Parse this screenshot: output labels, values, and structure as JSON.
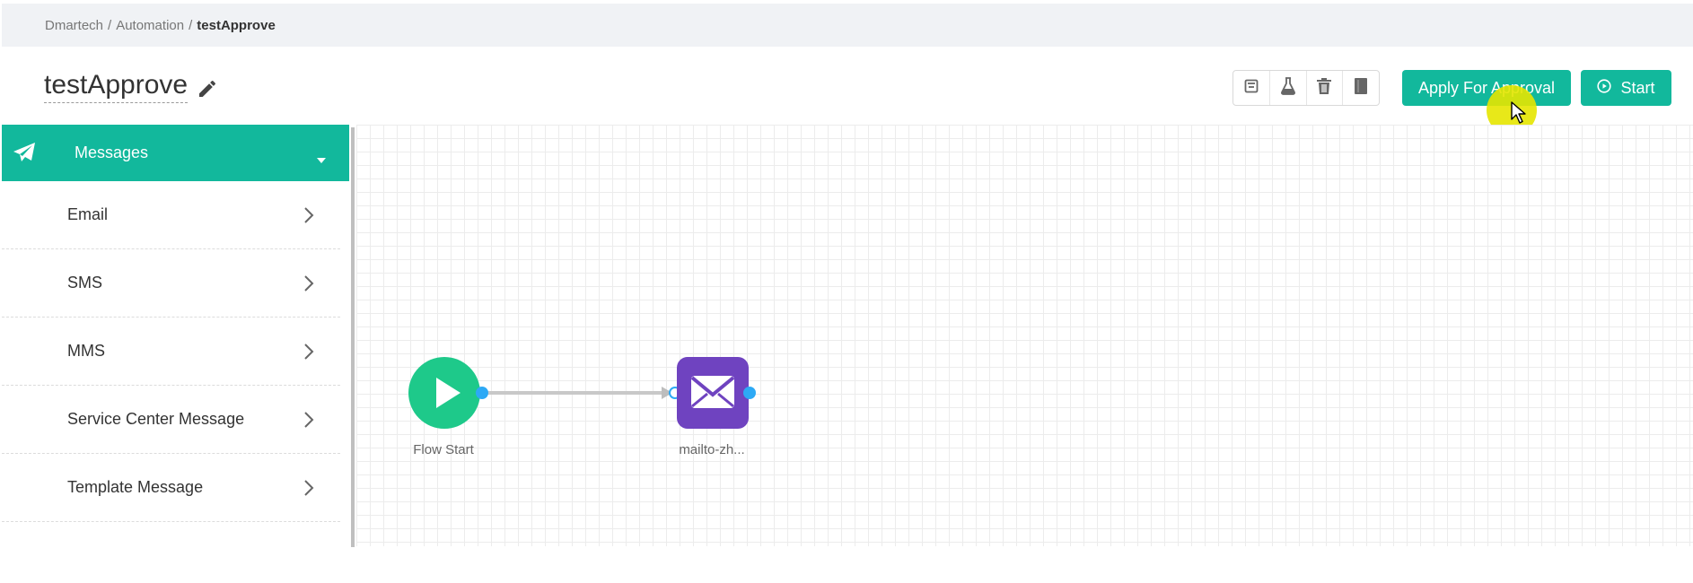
{
  "breadcrumb": {
    "items": [
      "Dmartech",
      "Automation"
    ],
    "separator": "/",
    "current": "testApprove"
  },
  "header": {
    "title": "testApprove",
    "edit_icon": "pencil-icon",
    "tools": [
      "save-icon",
      "flask-icon",
      "trash-icon",
      "notebook-icon"
    ],
    "apply_label": "Apply For Approval",
    "start_label": "Start",
    "accent": "#12b89c"
  },
  "sidebar": {
    "header_label": "Messages",
    "header_icon": "paper-plane-icon",
    "items": [
      {
        "label": "Email"
      },
      {
        "label": "SMS"
      },
      {
        "label": "MMS"
      },
      {
        "label": "Service Center Message"
      },
      {
        "label": "Template Message"
      }
    ]
  },
  "canvas": {
    "nodes": [
      {
        "label": "Flow Start",
        "type": "start",
        "color": "#1ec98a"
      },
      {
        "label": "mailto-zh...",
        "type": "email",
        "color": "#6f43c0"
      }
    ],
    "port_color": "#2da9f5",
    "edge_color": "#c8c8c8"
  }
}
